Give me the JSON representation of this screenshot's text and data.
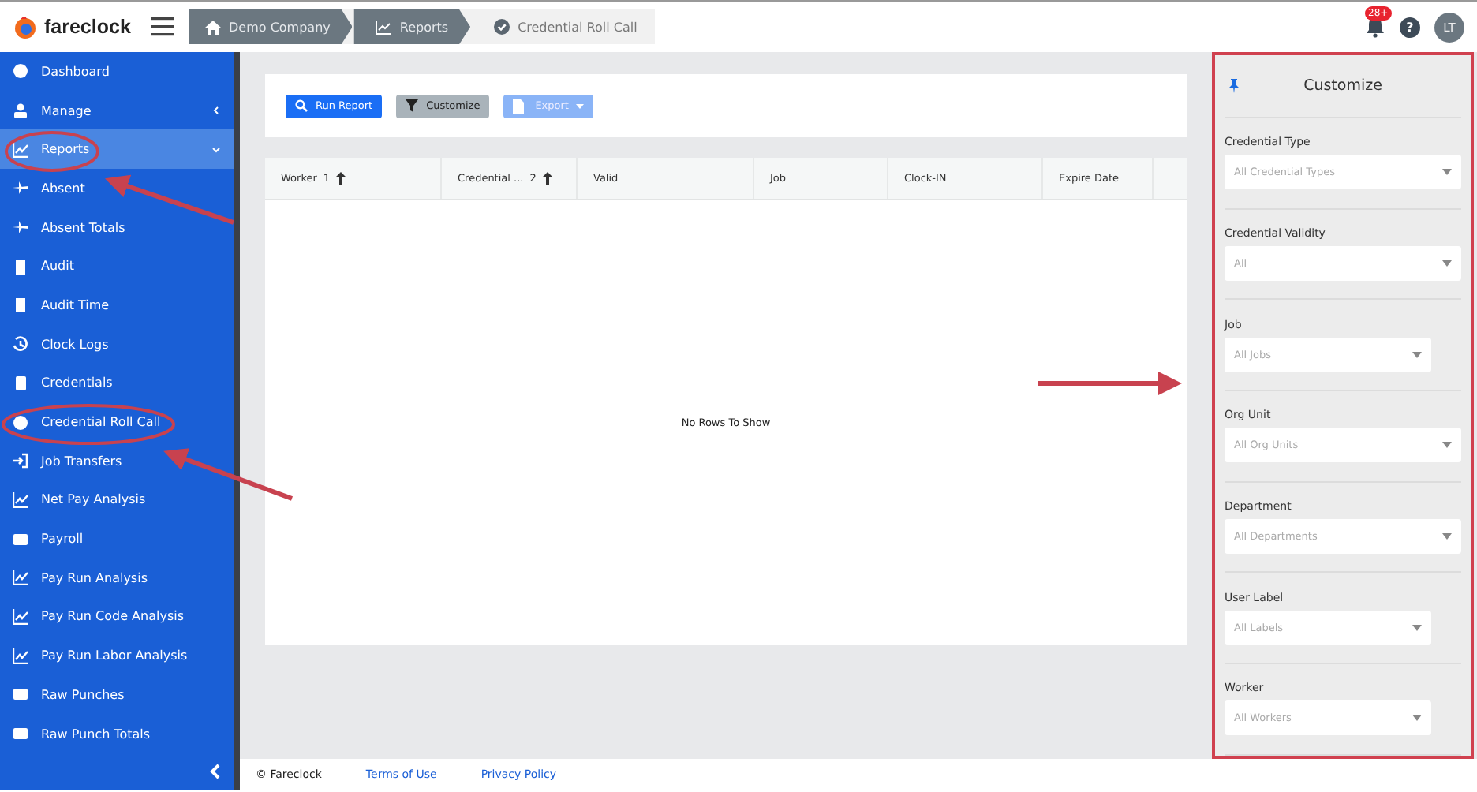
{
  "header": {
    "brand": "fareclock",
    "breadcrumbs": [
      {
        "label": "Demo Company",
        "current": false
      },
      {
        "label": "Reports",
        "current": false
      },
      {
        "label": "Credential Roll Call",
        "current": true
      }
    ],
    "notifications_badge": "28+",
    "help": "?",
    "avatar": "LT"
  },
  "sidebar": {
    "items": [
      {
        "label": "Dashboard",
        "selected": false
      },
      {
        "label": "Manage",
        "selected": false,
        "expanded": false
      },
      {
        "label": "Reports",
        "selected": true,
        "expanded": true
      },
      {
        "label": "Absent",
        "selected": false
      },
      {
        "label": "Absent Totals",
        "selected": false
      },
      {
        "label": "Audit",
        "selected": false
      },
      {
        "label": "Audit Time",
        "selected": false
      },
      {
        "label": "Clock Logs",
        "selected": false
      },
      {
        "label": "Credentials",
        "selected": false
      },
      {
        "label": "Credential Roll Call",
        "selected": false
      },
      {
        "label": "Job Transfers",
        "selected": false
      },
      {
        "label": "Net Pay Analysis",
        "selected": false
      },
      {
        "label": "Payroll",
        "selected": false
      },
      {
        "label": "Pay Run Analysis",
        "selected": false
      },
      {
        "label": "Pay Run Code Analysis",
        "selected": false
      },
      {
        "label": "Pay Run Labor Analysis",
        "selected": false
      },
      {
        "label": "Raw Punches",
        "selected": false
      },
      {
        "label": "Raw Punch Totals",
        "selected": false
      }
    ]
  },
  "toolbar": {
    "buttons": [
      {
        "kind": "primary",
        "label": "Run Report",
        "disabled": false
      },
      {
        "kind": "secondary",
        "label": "Customize",
        "disabled": false
      },
      {
        "kind": "dropdown",
        "label": "Export",
        "disabled": true
      }
    ]
  },
  "table": {
    "columns": [
      {
        "label": "Worker",
        "sort_order": "1"
      },
      {
        "label": "Credential ...",
        "sort_order": "2"
      },
      {
        "label": "Valid"
      },
      {
        "label": "Job"
      },
      {
        "label": "Clock-IN"
      },
      {
        "label": "Expire Date"
      }
    ],
    "empty_message": "No Rows To Show"
  },
  "customize_panel": {
    "title": "Customize",
    "filters": [
      {
        "label": "Credential Type",
        "placeholder": "All Credential Types",
        "compact": false
      },
      {
        "label": "Credential Validity",
        "placeholder": "All",
        "compact": false
      },
      {
        "label": "Job",
        "placeholder": "All Jobs",
        "compact": true
      },
      {
        "label": "Org Unit",
        "placeholder": "All Org Units",
        "compact": false
      },
      {
        "label": "Department",
        "placeholder": "All Departments",
        "compact": false
      },
      {
        "label": "User Label",
        "placeholder": "All Labels",
        "compact": true
      },
      {
        "label": "Worker",
        "placeholder": "All Workers",
        "compact": true
      }
    ]
  },
  "footer": {
    "copyright": "© Fareclock",
    "links": [
      "Terms of Use",
      "Privacy Policy"
    ]
  }
}
